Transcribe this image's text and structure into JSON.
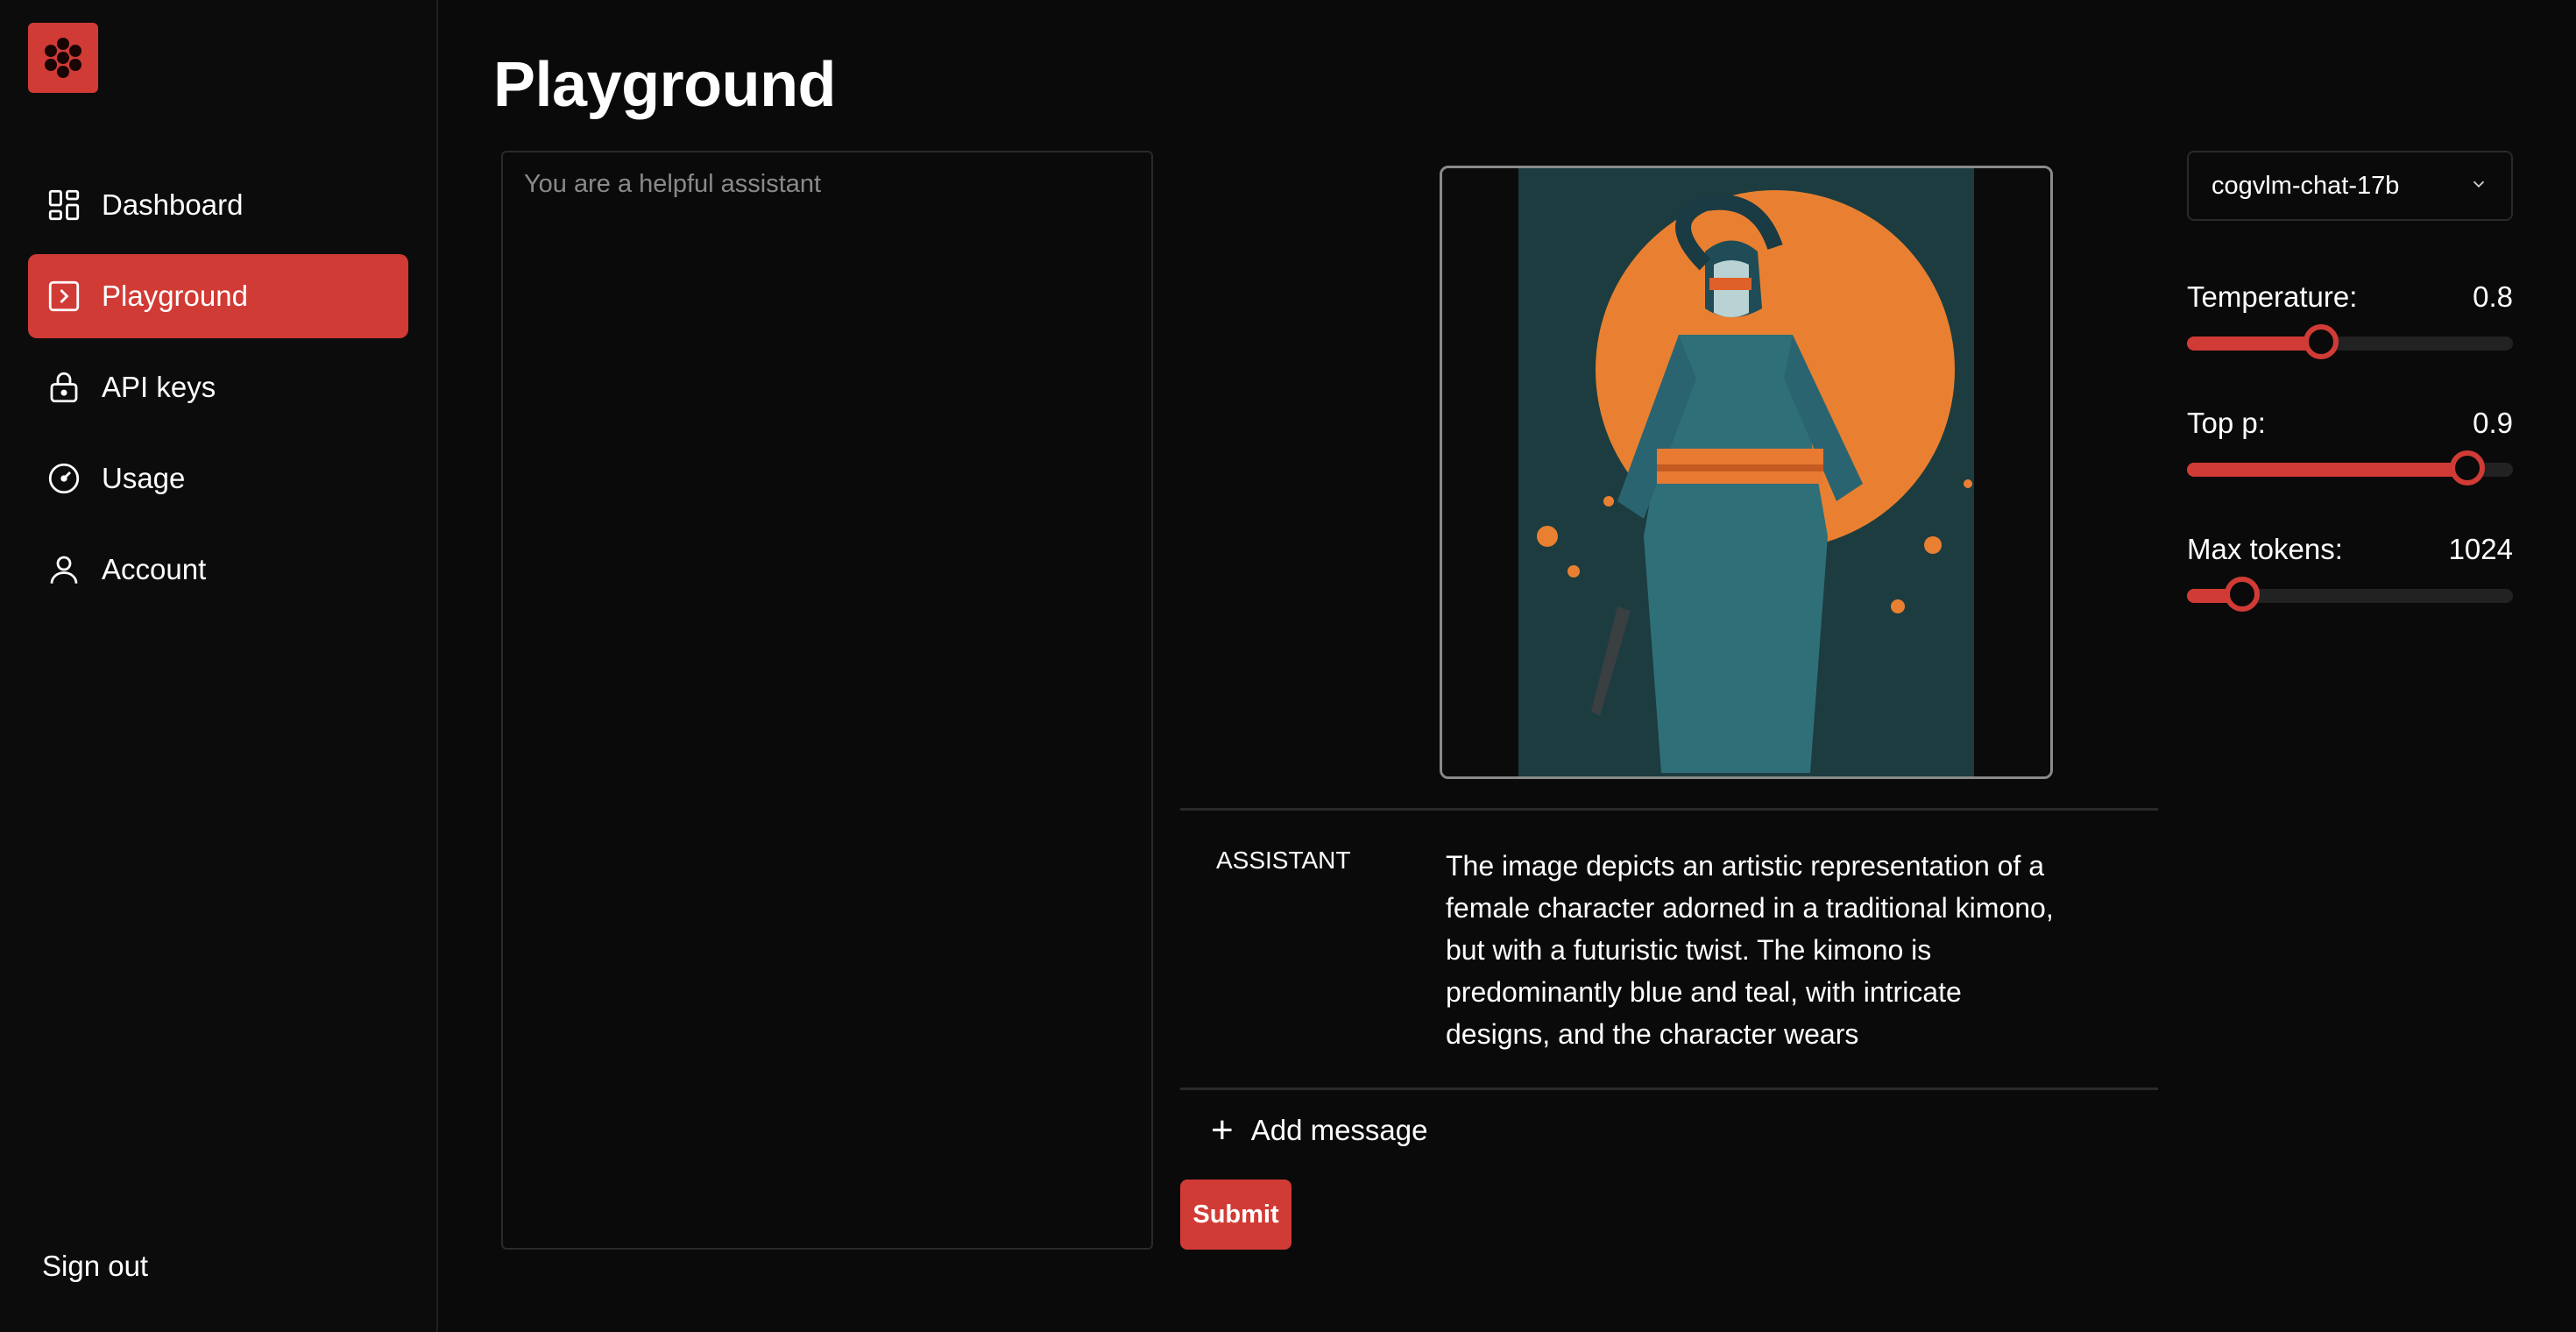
{
  "sidebar": {
    "items": [
      {
        "label": "Dashboard",
        "icon": "dashboard-icon",
        "active": false
      },
      {
        "label": "Playground",
        "icon": "terminal-icon",
        "active": true
      },
      {
        "label": "API keys",
        "icon": "lock-icon",
        "active": false
      },
      {
        "label": "Usage",
        "icon": "gauge-icon",
        "active": false
      },
      {
        "label": "Account",
        "icon": "user-icon",
        "active": false
      }
    ],
    "signout_label": "Sign out"
  },
  "page": {
    "title": "Playground"
  },
  "system_prompt": {
    "placeholder": "You are a helpful assistant",
    "value": ""
  },
  "conversation": {
    "role": "ASSISTANT",
    "text": "The image depicts an artistic representation of a female character adorned in a traditional kimono, but with a futuristic twist. The kimono is predominantly blue and teal, with intricate designs, and the character wears",
    "add_message_label": "Add message"
  },
  "submit_label": "Submit",
  "settings": {
    "model": "cogvlm-chat-17b",
    "temperature": {
      "label": "Temperature:",
      "value": "0.8",
      "fraction": 0.41
    },
    "top_p": {
      "label": "Top p:",
      "value": "0.9",
      "fraction": 0.86
    },
    "max_tokens": {
      "label": "Max tokens:",
      "value": "1024",
      "fraction": 0.17
    }
  },
  "colors": {
    "accent": "#d13b35",
    "background": "#0a0a0a",
    "border": "#2a2a2a"
  }
}
